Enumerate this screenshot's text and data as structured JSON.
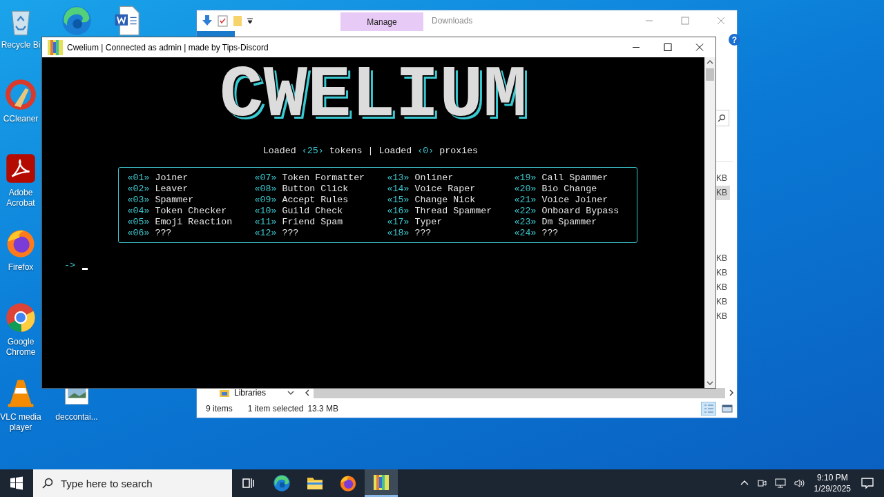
{
  "desktop_icons": [
    {
      "kind": "recycle",
      "label": "Recycle Bi"
    },
    {
      "kind": "edge"
    },
    {
      "kind": "word"
    },
    {
      "kind": "ccleaner",
      "label": "CCleaner"
    },
    {
      "kind": "acrobat",
      "label": "Adobe Acrobat"
    },
    {
      "kind": "firefox",
      "label": "Firefox"
    },
    {
      "kind": "chrome",
      "label": "Google Chrome"
    },
    {
      "kind": "vlc",
      "label": "VLC media player"
    },
    {
      "kind": "image",
      "label": "deccontai..."
    }
  ],
  "explorer": {
    "ribbon_tab": "Manage",
    "title": "Downloads",
    "help": "?",
    "rows": [
      {
        "size": "KB",
        "selected": false
      },
      {
        "size": "KB",
        "selected": true
      },
      {
        "size": "KB",
        "selected": false
      },
      {
        "size": "KB",
        "selected": false
      },
      {
        "size": "KB",
        "selected": false
      },
      {
        "size": "KB",
        "selected": false
      },
      {
        "size": "KB",
        "selected": false
      }
    ],
    "nav_item": "Libraries",
    "status_bar": {
      "items": "9 items",
      "selection": "1 item selected",
      "size": "13.3 MB"
    }
  },
  "console": {
    "title": "Cwelium | Connected as admin | made by Tips-Discord",
    "logo": "CWELIUM",
    "status_line": [
      {
        "text": "Loaded ",
        "accent": false
      },
      {
        "text": "‹25›",
        "accent": true
      },
      {
        "text": " tokens | Loaded ",
        "accent": false
      },
      {
        "text": "‹0›",
        "accent": true
      },
      {
        "text": " proxies",
        "accent": false
      }
    ],
    "menu_columns": [
      [
        {
          "tag": "«01»",
          "label": "Joiner"
        },
        {
          "tag": "«02»",
          "label": "Leaver"
        },
        {
          "tag": "«03»",
          "label": "Spammer"
        },
        {
          "tag": "«04»",
          "label": "Token Checker"
        },
        {
          "tag": "«05»",
          "label": "Emoji Reaction"
        },
        {
          "tag": "«06»",
          "label": "???"
        }
      ],
      [
        {
          "tag": "«07»",
          "label": "Token Formatter"
        },
        {
          "tag": "«08»",
          "label": "Button Click"
        },
        {
          "tag": "«09»",
          "label": "Accept Rules"
        },
        {
          "tag": "«10»",
          "label": "Guild Check"
        },
        {
          "tag": "«11»",
          "label": "Friend Spam"
        },
        {
          "tag": "«12»",
          "label": "???"
        }
      ],
      [
        {
          "tag": "«13»",
          "label": "Onliner"
        },
        {
          "tag": "«14»",
          "label": "Voice Raper"
        },
        {
          "tag": "«15»",
          "label": "Change Nick"
        },
        {
          "tag": "«16»",
          "label": "Thread Spammer"
        },
        {
          "tag": "«17»",
          "label": "Typer"
        },
        {
          "tag": "«18»",
          "label": "???"
        }
      ],
      [
        {
          "tag": "«19»",
          "label": "Call Spammer"
        },
        {
          "tag": "«20»",
          "label": "Bio Change"
        },
        {
          "tag": "«21»",
          "label": "Voice Joiner"
        },
        {
          "tag": "«22»",
          "label": "Onboard Bypass"
        },
        {
          "tag": "«23»",
          "label": "Dm Spammer"
        },
        {
          "tag": "«24»",
          "label": "???"
        }
      ]
    ],
    "prompt": "->"
  },
  "taskbar": {
    "search_placeholder": "Type here to search",
    "apps": [
      {
        "kind": "taskview",
        "selected": false
      },
      {
        "kind": "edge",
        "selected": false
      },
      {
        "kind": "explorer",
        "selected": false
      },
      {
        "kind": "firefox",
        "selected": false
      },
      {
        "kind": "cwelium",
        "selected": true
      }
    ],
    "time": "9:10 PM",
    "date": "1/29/2025"
  }
}
